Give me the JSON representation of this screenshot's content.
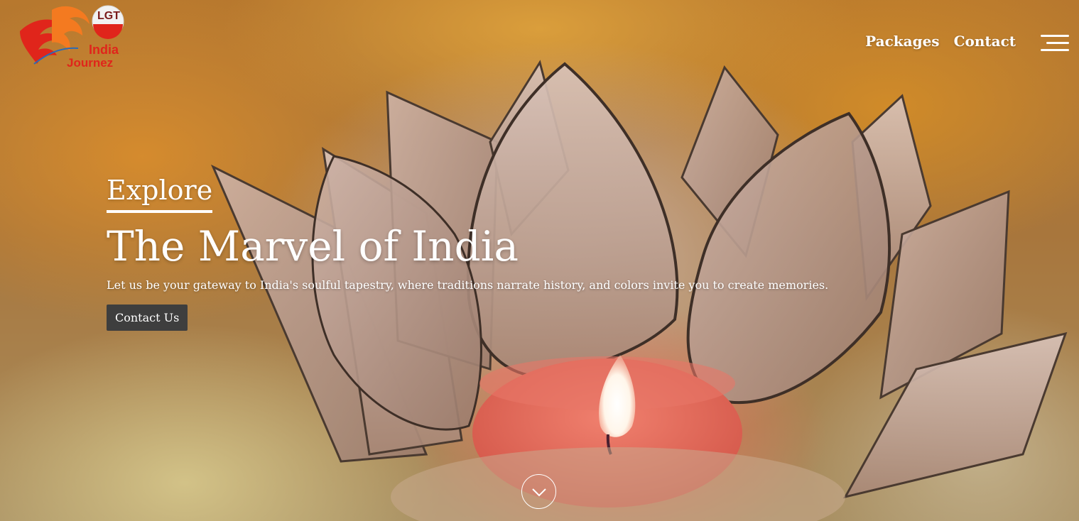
{
  "brand": {
    "badge": "LGT",
    "name_line1": "India",
    "name_line2": "Journez",
    "colors": {
      "primary": "#e0251b",
      "accent": "#f47a20",
      "badge_bg": "#f2f2f2"
    }
  },
  "nav": {
    "items": [
      {
        "label": "Packages"
      },
      {
        "label": "Contact"
      }
    ],
    "menu_icon": "hamburger-menu-icon"
  },
  "hero": {
    "eyebrow": "Explore",
    "title": "The Marvel of India",
    "tagline": "Let us be your gateway to India's soulful tapestry, where traditions narrate history, and colors invite you to create memories.",
    "cta_label": "Contact Us",
    "scroll_icon": "chevron-down-icon"
  },
  "colors": {
    "text": "#ffffff",
    "button_bg": "#3e3e3e"
  }
}
